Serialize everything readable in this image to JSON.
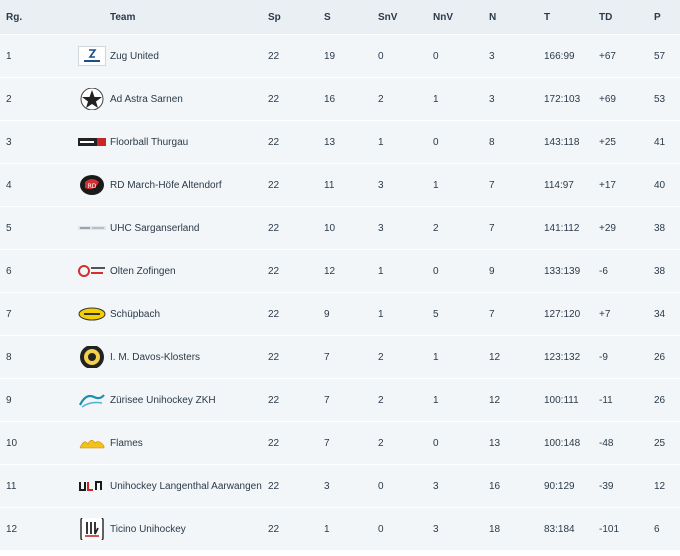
{
  "columns": [
    "Rg.",
    "Team",
    "Sp",
    "S",
    "SnV",
    "NnV",
    "N",
    "T",
    "TD",
    "P"
  ],
  "rows": [
    {
      "rank": "1",
      "team": "Zug United",
      "sp": "22",
      "s": "19",
      "snv": "0",
      "nnv": "0",
      "n": "3",
      "t": "166:99",
      "td": "+67",
      "p": "57",
      "logo": "zug-united-logo"
    },
    {
      "rank": "2",
      "team": "Ad Astra Sarnen",
      "sp": "22",
      "s": "16",
      "snv": "2",
      "nnv": "1",
      "n": "3",
      "t": "172:103",
      "td": "+69",
      "p": "53",
      "logo": "ad-astra-sarnen-logo"
    },
    {
      "rank": "3",
      "team": "Floorball Thurgau",
      "sp": "22",
      "s": "13",
      "snv": "1",
      "nnv": "0",
      "n": "8",
      "t": "143:118",
      "td": "+25",
      "p": "41",
      "logo": "floorball-thurgau-logo"
    },
    {
      "rank": "4",
      "team": "RD March-Höfe Altendorf",
      "sp": "22",
      "s": "11",
      "snv": "3",
      "nnv": "1",
      "n": "7",
      "t": "114:97",
      "td": "+17",
      "p": "40",
      "logo": "rd-march-hoefe-logo"
    },
    {
      "rank": "5",
      "team": "UHC Sarganserland",
      "sp": "22",
      "s": "10",
      "snv": "3",
      "nnv": "2",
      "n": "7",
      "t": "141:112",
      "td": "+29",
      "p": "38",
      "logo": "uhc-sarganserland-logo"
    },
    {
      "rank": "6",
      "team": "Olten Zofingen",
      "sp": "22",
      "s": "12",
      "snv": "1",
      "nnv": "0",
      "n": "9",
      "t": "133:139",
      "td": "-6",
      "p": "38",
      "logo": "olten-zofingen-logo"
    },
    {
      "rank": "7",
      "team": "Schüpbach",
      "sp": "22",
      "s": "9",
      "snv": "1",
      "nnv": "5",
      "n": "7",
      "t": "127:120",
      "td": "+7",
      "p": "34",
      "logo": "schuepbach-logo"
    },
    {
      "rank": "8",
      "team": "I. M. Davos-Klosters",
      "sp": "22",
      "s": "7",
      "snv": "2",
      "nnv": "1",
      "n": "12",
      "t": "123:132",
      "td": "-9",
      "p": "26",
      "logo": "davos-klosters-logo"
    },
    {
      "rank": "9",
      "team": "Zürisee Unihockey ZKH",
      "sp": "22",
      "s": "7",
      "snv": "2",
      "nnv": "1",
      "n": "12",
      "t": "100:111",
      "td": "-11",
      "p": "26",
      "logo": "zuerisee-logo"
    },
    {
      "rank": "10",
      "team": "Flames",
      "sp": "22",
      "s": "7",
      "snv": "2",
      "nnv": "0",
      "n": "13",
      "t": "100:148",
      "td": "-48",
      "p": "25",
      "logo": "flames-logo"
    },
    {
      "rank": "11",
      "team": "Unihockey Langenthal Aarwangen",
      "sp": "22",
      "s": "3",
      "snv": "0",
      "nnv": "3",
      "n": "16",
      "t": "90:129",
      "td": "-39",
      "p": "12",
      "logo": "langenthal-aarwangen-logo"
    },
    {
      "rank": "12",
      "team": "Ticino Unihockey",
      "sp": "22",
      "s": "1",
      "snv": "0",
      "nnv": "3",
      "n": "18",
      "t": "83:184",
      "td": "-101",
      "p": "6",
      "logo": "ticino-logo"
    }
  ],
  "colors": {
    "header_bg": "#e9eff3",
    "row_bg": "#f3f6f8",
    "text": "#2b3a4a"
  }
}
